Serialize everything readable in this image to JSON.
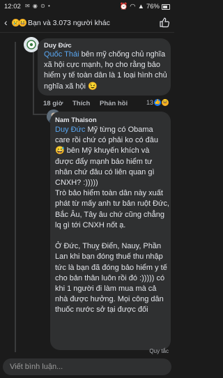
{
  "status_bar": {
    "time": "12:02",
    "battery": "76%",
    "battery_level": 0.76
  },
  "reactions_header": {
    "summary": "Bạn và 3.073 người khác",
    "back_icon": "chevron-left-icon",
    "reaction_icons": [
      "sad-emoji-icon",
      "haha-emoji-icon"
    ]
  },
  "comments": [
    {
      "author": "Duy Đức",
      "mention": "Quốc Thái",
      "text": " bên mỹ chống chủ nghĩa xã hội cực mạnh, họ cho rằng bảo hiểm y tế toàn dân là 1 loại hình chủ nghĩa xã hội 😉",
      "time": "18 giờ",
      "like_label": "Thích",
      "reply_label": "Phản hồi",
      "reaction_count": "13"
    },
    {
      "author": "Nam Thaison",
      "mention": "Duy Đức",
      "text": " Mỹ từng có Obama care rồi chứ có phải ko có đâu 😅 bên Mỹ khuyến khích và được đẩy mạnh bảo hiểm tư nhân chứ đâu có liên quan gì CNXH? :)))))\nTrò bảo hiểm toàn dân này xuất phát từ mấy anh tư bản ruột Đức, Bắc Âu, Tây âu chứ cũng chẳng lq gì tới CNXH nốt ạ.\n\nỞ Đức, Thuỵ Điển, Nauy, Phần Lan khi bạn đóng thuế thu nhập tức là bạn đã đóng bảo hiểm y tế cho bản thân luôn rồi đó :))))) có khi 1 người đi làm mua mà cả nhà được hưởng. Mọi công dân thuốc nước sở tại được đối"
    }
  ],
  "footer": {
    "rules_label": "Quy tắc",
    "composer_placeholder": "Viết bình luận..."
  },
  "colors": {
    "background": "#1b1b1b",
    "bubble": "#2f3031",
    "mention": "#5aa7f2",
    "secondary_text": "#b0b3b8"
  }
}
